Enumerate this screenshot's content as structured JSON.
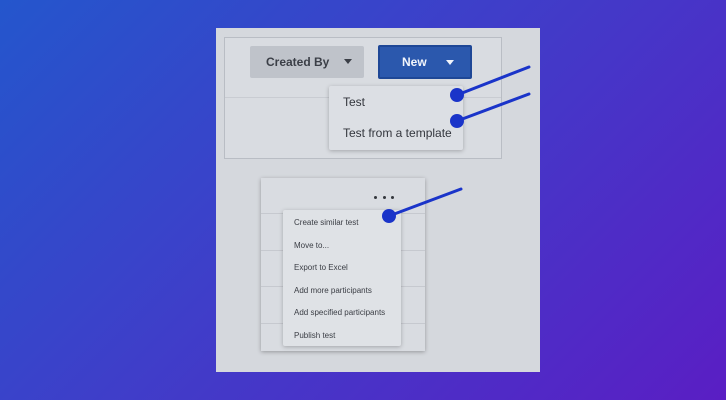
{
  "toolbar": {
    "created_by_label": "Created By",
    "new_label": "New"
  },
  "new_menu": {
    "items": [
      "Test",
      "Test from a template"
    ]
  },
  "row_menu": {
    "items": [
      "Create similar test",
      "Move to...",
      "Export to Excel",
      "Add more participants",
      "Add specified participants",
      "Publish test"
    ]
  },
  "colors": {
    "background_start": "#2456cc",
    "background_end": "#5a1ec4",
    "panel": "#d5d8dd",
    "new_button": "#2b58ad",
    "annotation": "#1a34c9"
  }
}
